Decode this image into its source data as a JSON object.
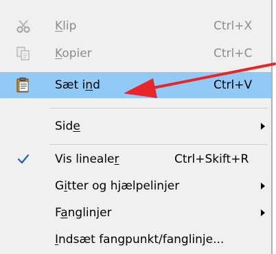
{
  "menu": {
    "items": [
      {
        "label_parts": [
          "",
          "K",
          "lip"
        ],
        "shortcut": "Ctrl+X",
        "icon": "scissors-icon",
        "disabled": true
      },
      {
        "label_parts": [
          "",
          "K",
          "opier"
        ],
        "shortcut": "Ctrl+C",
        "icon": "copy-icon",
        "disabled": true
      },
      {
        "label_parts": [
          "Sæt i",
          "n",
          "d"
        ],
        "shortcut": "Ctrl+V",
        "icon": "clipboard-paste-icon",
        "highlighted": true
      },
      {
        "label_parts": [
          "Sid",
          "e",
          ""
        ],
        "submenu": true
      },
      {
        "label_parts": [
          "Vis lineale",
          "r",
          ""
        ],
        "shortcut": "Ctrl+Skift+R",
        "icon": "checkmark-icon",
        "checked": true
      },
      {
        "label_parts": [
          "G",
          "i",
          "tter og hjælpelinjer"
        ],
        "submenu": true
      },
      {
        "label_parts": [
          "F",
          "a",
          "nglinjer"
        ],
        "submenu": true
      },
      {
        "label_parts": [
          "",
          "I",
          "ndsæt fangpunkt/fanglinje..."
        ]
      }
    ]
  },
  "colors": {
    "highlight": "#91c9f7",
    "annotation_arrow": "#e8262a"
  }
}
